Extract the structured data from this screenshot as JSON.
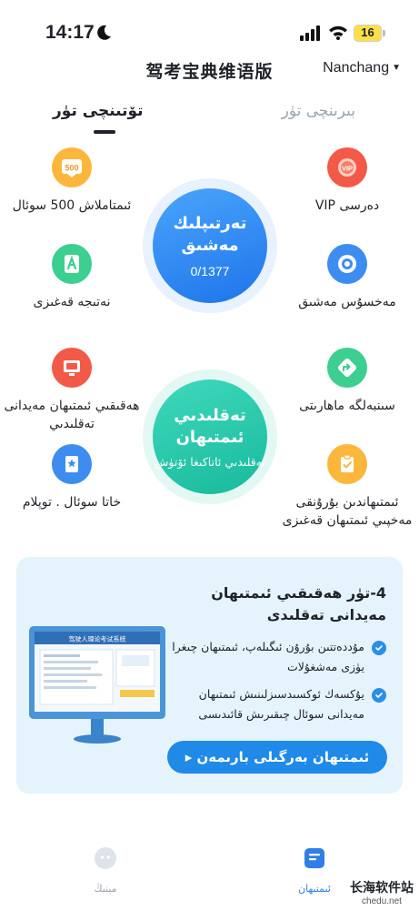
{
  "status_bar": {
    "time": "14:17",
    "battery": "16"
  },
  "header": {
    "title": "驾考宝典维语版",
    "city": "Nanchang"
  },
  "tabs": {
    "active": "تۆتىنچى تۈر",
    "inactive": "بىرىنچى تۈر"
  },
  "features": {
    "vip": "دەرسى VIP",
    "exam500": "ئىمتاملاش 500 سوئال",
    "special": "مەخسۇس مەشىق",
    "result": "نەتىجە قەغىزى",
    "skills": "سىنبەلگە ماھارىتى",
    "real_exam": "ھەقىقىي ئىمتىھان مەيدانى تەقلىدىي",
    "wrong": "خاتا سوئال . توپلام",
    "paper": "ئىمتىھاندىن بۇرۇنقى مەخپىي ئىمتىھان قەغىزى"
  },
  "practice_circle": {
    "title": "تەرتىپلىك مەشىق",
    "count": "0/1377"
  },
  "mock_circle": {
    "title": "تەقلىدىي ئىمتىھان",
    "subtitle": "تەقلىدىي ئاتاكىغا ئۆتۈش"
  },
  "promo": {
    "title": "4-تۈر ھەقىقىي ئىمتىھان مەيدانى تەقلىدى",
    "bullet1": "مۇددەتتىن بۇرۇن ئىگىلەپ، ئىمتىھان چىغرا يۈزى مەشغۇلات",
    "bullet2": "يۇكسەك ئوكسىدسىزلىنىش ئىمتىھان مەيدانى سوئال چىقىرىش قائىدىسى",
    "button": "ئىمتىھان بەرگىلى بارىمەن ▸",
    "screen_title": "驾驶人理论考试系统"
  },
  "nav": {
    "profile": "مېنىڭ",
    "exam": "ئىمتىھان"
  },
  "watermark": {
    "main": "长海软件站",
    "sub": "chedu.net"
  },
  "colors": {
    "blue_accent": "#1f8ae8",
    "teal_accent": "#1fc4a8",
    "orange": "#f7a52b",
    "red": "#f25a47",
    "green": "#3ccf90"
  }
}
